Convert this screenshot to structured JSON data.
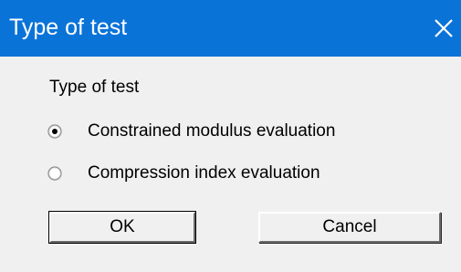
{
  "window": {
    "title": "Type of test",
    "titlebar_color": "#0a73d8",
    "background_color": "#f0f0f0"
  },
  "titlebar": {
    "close_icon": "close-icon"
  },
  "group": {
    "label": "Type of test",
    "options": [
      {
        "label": "Constrained modulus evaluation",
        "selected": true
      },
      {
        "label": "Compression index evaluation",
        "selected": false
      }
    ]
  },
  "buttons": {
    "ok_label": "OK",
    "cancel_label": "Cancel"
  }
}
